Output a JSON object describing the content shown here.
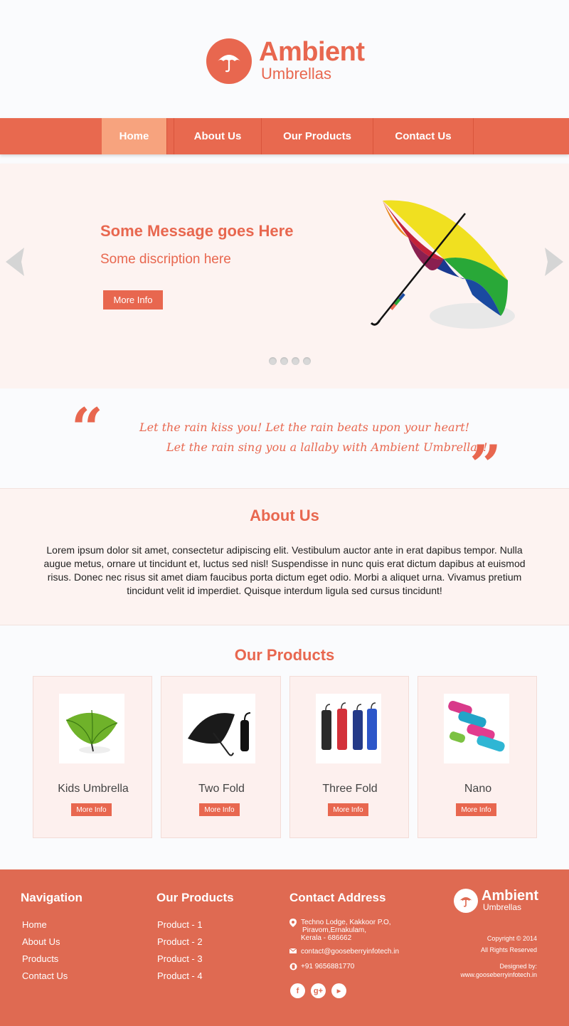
{
  "header": {
    "brand_title": "Ambient",
    "brand_sub": "Umbrellas"
  },
  "nav": {
    "items": [
      "Home",
      "About Us",
      "Our Products",
      "Contact Us"
    ],
    "active": "Home"
  },
  "slider": {
    "title": "Some Message goes Here",
    "description": "Some discription here",
    "button": "More Info",
    "dots": 4
  },
  "quote": {
    "line1": "Let the rain kiss you! Let the rain beats upon your heart!",
    "line2": "Let the rain sing you a lallaby with Ambient Umbrellas!"
  },
  "about": {
    "title": "About Us",
    "text": "Lorem ipsum dolor sit amet, consectetur adipiscing elit. Vestibulum auctor ante in erat dapibus tempor. Nulla augue metus, ornare ut tincidunt et, luctus sed nisl! Suspendisse in nunc quis erat dictum dapibus at euismod risus. Donec nec risus sit amet diam faucibus porta dictum eget odio. Morbi a aliquet urna. Vivamus pretium tincidunt velit id imperdiet. Quisque interdum ligula sed cursus tincidunt!"
  },
  "products": {
    "title": "Our Products",
    "items": [
      {
        "name": "Kids Umbrella",
        "button": "More Info"
      },
      {
        "name": "Two Fold",
        "button": "More Info"
      },
      {
        "name": "Three Fold",
        "button": "More Info"
      },
      {
        "name": "Nano",
        "button": "More Info"
      }
    ]
  },
  "footer": {
    "nav_heading": "Navigation",
    "nav_links": [
      "Home",
      "About Us",
      "Products",
      "Contact Us"
    ],
    "products_heading": "Our Products",
    "product_links": [
      "Product - 1",
      "Product - 2",
      "Product - 3",
      "Product - 4"
    ],
    "contact_heading": "Contact Address",
    "address_1": "Techno Lodge, Kakkoor P.O,",
    "address_2": "Piravom,Ernakulam,",
    "address_3": "Kerala - 686662",
    "email": "contact@gooseberryinfotech.in",
    "phone": "+91 9656881770",
    "brand_title": "Ambient",
    "brand_sub": "Umbrellas",
    "copyright_1": "Copyright © 2014",
    "copyright_2": "All Rights Reserved",
    "designed_1": "Designed by:",
    "designed_2": "www.gooseberryinfotech.in"
  },
  "colors": {
    "accent": "#e8674f",
    "nav_active": "#f7a37e",
    "footer_bg": "#df6a52",
    "section_tint": "#fdf3f1"
  }
}
